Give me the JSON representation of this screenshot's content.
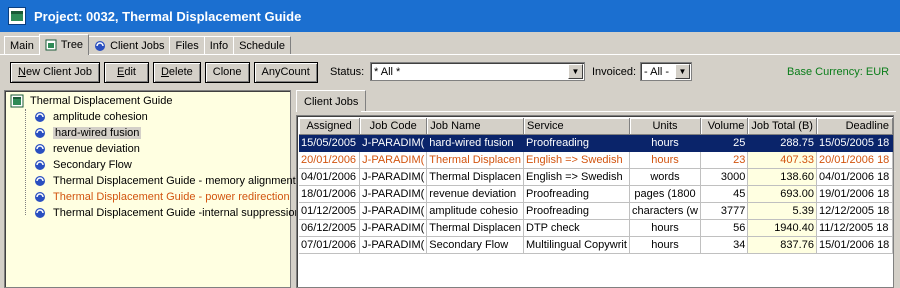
{
  "window": {
    "title": "Project: 0032, Thermal Displacement Guide"
  },
  "tabs": [
    {
      "label": "Main",
      "icon": ""
    },
    {
      "label": "Tree",
      "icon": "tree-icon"
    },
    {
      "label": "Client Jobs",
      "icon": "globe-icon"
    },
    {
      "label": "Files",
      "icon": ""
    },
    {
      "label": "Info",
      "icon": ""
    },
    {
      "label": "Schedule",
      "icon": ""
    }
  ],
  "toolbar": {
    "new_client_job": {
      "pre": "",
      "u": "N",
      "post": "ew Client Job"
    },
    "edit": {
      "pre": "",
      "u": "E",
      "post": "dit"
    },
    "delete": {
      "pre": "",
      "u": "D",
      "post": "elete"
    },
    "clone": "Clone",
    "anycount": "AnyCount",
    "status_label": "Status:",
    "status_value": "* All *",
    "invoiced_label": "Invoiced:",
    "invoiced_value": "- All -",
    "currency": "Base Currency: EUR"
  },
  "tree": {
    "root": "Thermal Displacement Guide",
    "items": [
      {
        "label": "amplitude cohesion",
        "state": "normal"
      },
      {
        "label": "hard-wired fusion",
        "state": "selected"
      },
      {
        "label": "revenue deviation",
        "state": "normal"
      },
      {
        "label": "Secondary Flow",
        "state": "normal"
      },
      {
        "label": "Thermal Displacement Guide - memory alignment",
        "state": "normal"
      },
      {
        "label": "Thermal Displacement Guide - power redirection",
        "state": "late"
      },
      {
        "label": "Thermal Displacement Guide -internal suppression",
        "state": "normal"
      }
    ]
  },
  "subtab": "Client Jobs",
  "table": {
    "columns": [
      "Assigned",
      "Job Code",
      "Job Name",
      "Service",
      "Units",
      "Volume",
      "Job Total (B)",
      "Deadline"
    ],
    "rows": [
      [
        "15/05/2005",
        "J-PARADIM(",
        "hard-wired fusion",
        "Proofreading",
        "hours",
        "25",
        "288.75",
        "15/05/2005 18"
      ],
      [
        "20/01/2006",
        "J-PARADIM(",
        "Thermal Displacen",
        "English => Swedish",
        "hours",
        "23",
        "407.33",
        "20/01/2006 18"
      ],
      [
        "04/01/2006",
        "J-PARADIM(",
        "Thermal Displacen",
        "English => Swedish",
        "words",
        "3000",
        "138.60",
        "04/01/2006 18"
      ],
      [
        "18/01/2006",
        "J-PARADIM(",
        "revenue deviation",
        "Proofreading",
        "pages (1800",
        "45",
        "693.00",
        "19/01/2006 18"
      ],
      [
        "01/12/2005",
        "J-PARADIM(",
        "amplitude cohesio",
        "Proofreading",
        "characters (w",
        "3777",
        "5.39",
        "12/12/2005 18"
      ],
      [
        "06/12/2005",
        "J-PARADIM(",
        "Thermal Displacen",
        "DTP check",
        "hours",
        "56",
        "1940.40",
        "11/12/2005 18"
      ],
      [
        "07/01/2006",
        "J-PARADIM(",
        "Secondary Flow",
        "Multilingual Copywrit",
        "hours",
        "34",
        "837.76",
        "15/01/2006 18"
      ]
    ],
    "row_states": [
      "selected",
      "late",
      "normal",
      "normal",
      "normal",
      "normal",
      "normal"
    ]
  },
  "colors": {
    "title_bar": "#1b6fd0",
    "selection": "#0a246a",
    "late": "#d2540f",
    "currency": "#0a7d1a",
    "tree_bg": "#ffffe1"
  }
}
